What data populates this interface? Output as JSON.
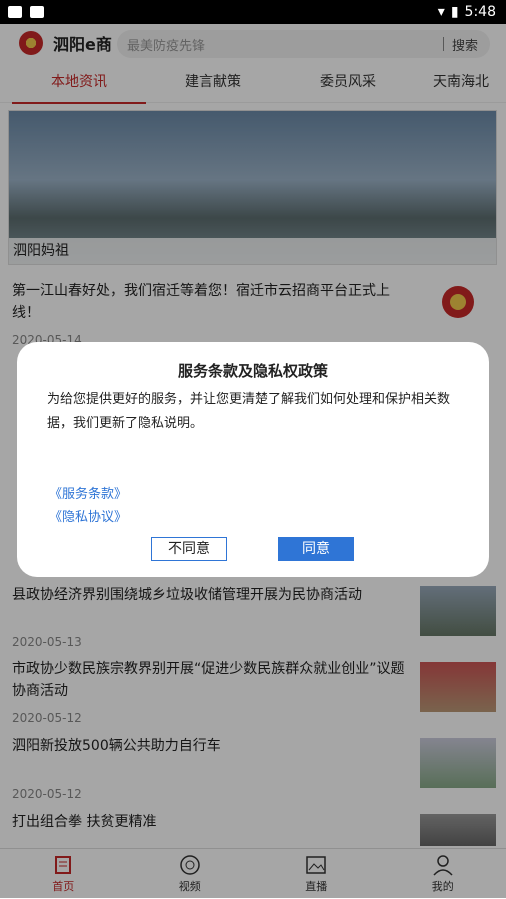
{
  "status_bar": {
    "time": "5:48"
  },
  "header": {
    "app_title": "泗阳e商",
    "search_placeholder": "最美防疫先锋",
    "search_button": "搜索"
  },
  "tabs": [
    {
      "label": "本地资讯"
    },
    {
      "label": "建言献策"
    },
    {
      "label": "委员风采"
    },
    {
      "label": "天南海北"
    }
  ],
  "banner": {
    "caption": "泗阳妈祖"
  },
  "news": [
    {
      "title": "第一江山春好处，我们宿迁等着您！宿迁市云招商平台正式上线！",
      "date": "2020-05-14"
    },
    {
      "title": "县政协经济界别围绕城乡垃圾收储管理开展为民协商活动",
      "date": "2020-05-13"
    },
    {
      "title": "市政协少数民族宗教界别开展“促进少数民族群众就业创业”议题协商活动",
      "date": "2020-05-12"
    },
    {
      "title": "泗阳新投放500辆公共助力自行车",
      "date": "2020-05-12"
    },
    {
      "title": "打出组合拳 扶贫更精准",
      "date": ""
    }
  ],
  "dialog": {
    "title": "服务条款及隐私权政策",
    "body": "为给您提供更好的服务，并让您更清楚了解我们如何处理和保护相关数据，我们更新了隐私说明。",
    "link_terms": "《服务条款》",
    "link_privacy": "《隐私协议》",
    "decline": "不同意",
    "agree": "同意"
  },
  "bottom_nav": [
    {
      "label": "首页"
    },
    {
      "label": "视频"
    },
    {
      "label": "直播"
    },
    {
      "label": "我的"
    }
  ]
}
